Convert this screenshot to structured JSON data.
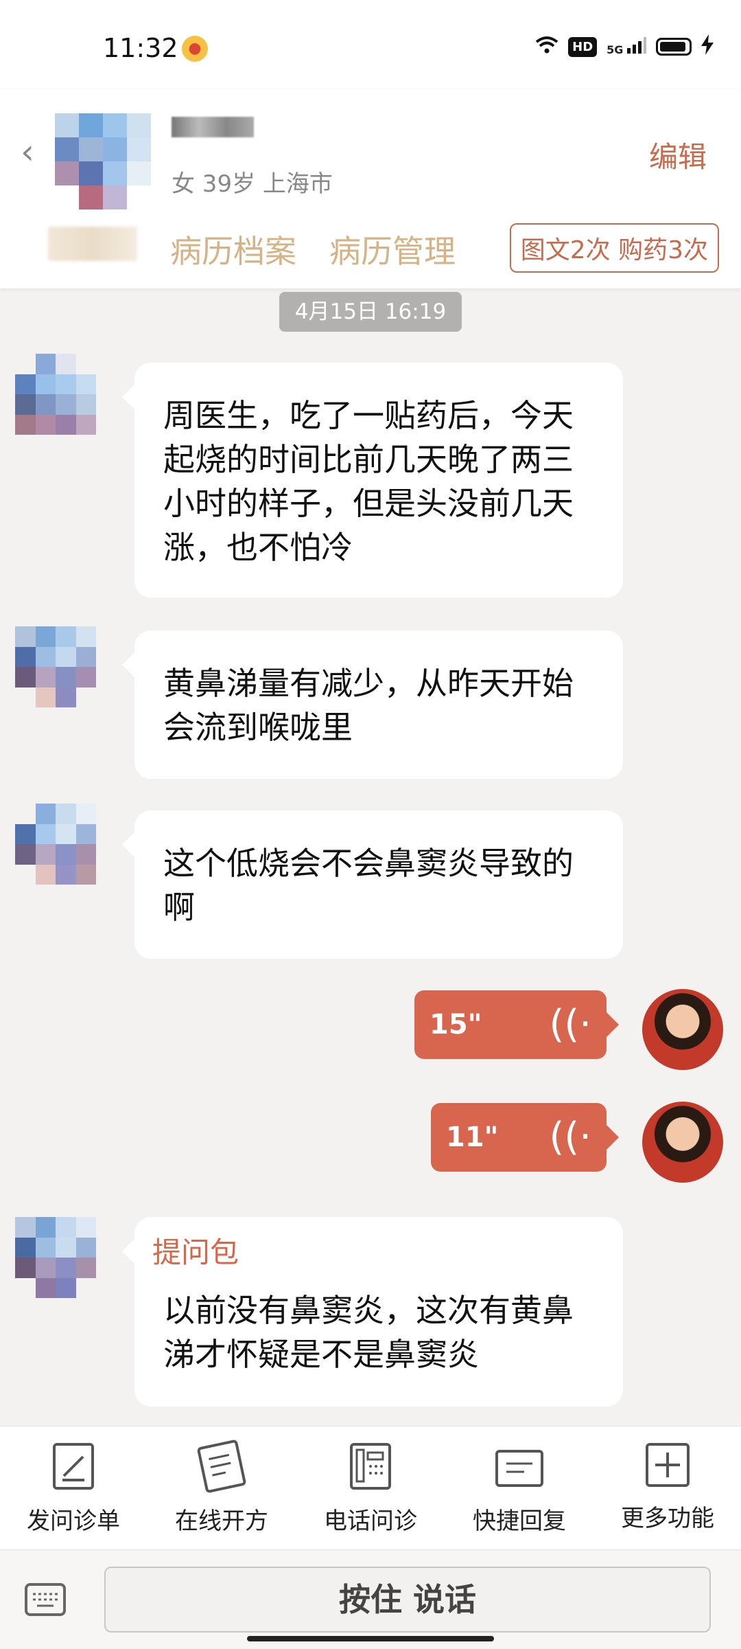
{
  "status_bar": {
    "time": "11:32",
    "weibo_icon": "weibo-icon",
    "hd": "HD",
    "network": "5G"
  },
  "header": {
    "patient_info": "女 39岁 上海市",
    "edit_label": "编辑",
    "tabs": [
      "病历档案",
      "病历管理"
    ],
    "tag": "图文2次 购药3次"
  },
  "chat": {
    "date": "4月15日 16:19",
    "messages": [
      {
        "text": "周医生，吃了一贴药后，今天起烧的时间比前几天晚了两三小时的样子，但是头没前几天涨，也不怕冷"
      },
      {
        "text": "黄鼻涕量有减少，从昨天开始会流到喉咙里"
      },
      {
        "text": "这个低烧会不会鼻窦炎导致的啊"
      }
    ],
    "voice": [
      {
        "duration": "15\""
      },
      {
        "duration": "11\""
      }
    ],
    "question_pack": {
      "title": "提问包",
      "text": "以前没有鼻窦炎，这次有黄鼻涕才怀疑是不是鼻窦炎"
    }
  },
  "toolbar": {
    "items": [
      {
        "label": "发问诊单",
        "icon": "form-icon"
      },
      {
        "label": "在线开方",
        "icon": "prescription-icon"
      },
      {
        "label": "电话问诊",
        "icon": "phone-icon"
      },
      {
        "label": "快捷回复",
        "icon": "quick-reply-icon"
      },
      {
        "label": "更多功能",
        "icon": "plus-icon"
      }
    ]
  },
  "input": {
    "talk_label": "按住 说话"
  },
  "colors": {
    "accent": "#d8654d",
    "tab_text": "#d6b385",
    "background": "#f3f2f0"
  }
}
